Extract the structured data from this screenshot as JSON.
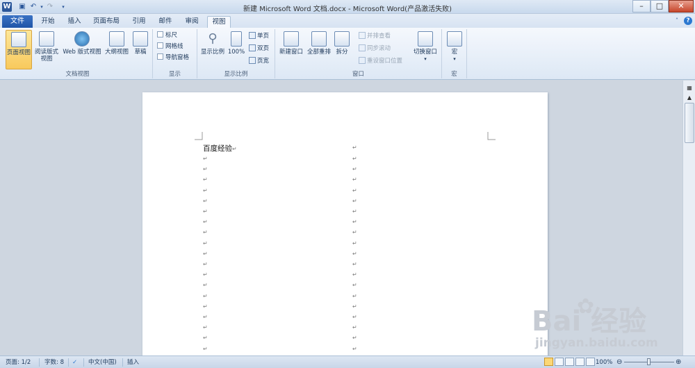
{
  "window": {
    "title": "新建 Microsoft Word 文档.docx - Microsoft Word(产品激活失败)",
    "app_icon": "W"
  },
  "tabs": {
    "file": "文件",
    "items": [
      "开始",
      "插入",
      "页面布局",
      "引用",
      "邮件",
      "审阅",
      "视图"
    ],
    "active": "视图"
  },
  "ribbon": {
    "doc_views": {
      "label": "文档视图",
      "print_layout": "页面视图",
      "reading_line1": "阅读版式",
      "reading_line2": "视图",
      "web_layout": "Web 版式视图",
      "outline": "大纲视图",
      "draft": "草稿"
    },
    "show": {
      "label": "显示",
      "ruler": "标尺",
      "gridlines": "网格线",
      "nav_pane": "导航窗格"
    },
    "zoom": {
      "label": "显示比例",
      "zoom": "显示比例",
      "hundred": "100%",
      "one_page": "单页",
      "two_pages": "双页",
      "page_width": "页宽"
    },
    "window": {
      "label": "窗口",
      "new_window": "新建窗口",
      "arrange_all": "全部重排",
      "split": "拆分",
      "side_by_side": "并排查看",
      "sync_scroll": "同步滚动",
      "reset_position": "重设窗口位置",
      "switch_windows": "切换窗口"
    },
    "macros": {
      "label": "宏",
      "macros": "宏"
    }
  },
  "document": {
    "text": "百度经验",
    "paragraph_mark": "↵"
  },
  "statusbar": {
    "page": "页面: 1/2",
    "words": "字数: 8",
    "language": "中文(中国)",
    "mode": "插入",
    "zoom": "100%"
  },
  "watermark": {
    "brand": "Bai  经验",
    "url": "jingyan.baidu.com"
  }
}
